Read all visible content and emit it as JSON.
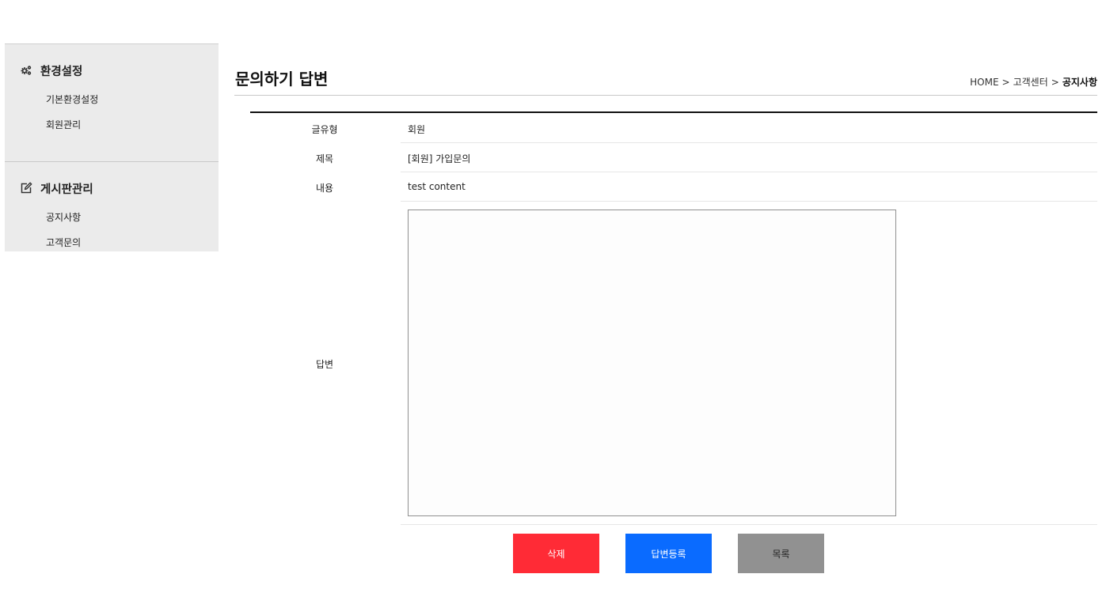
{
  "sidebar": {
    "groups": [
      {
        "title": "환경설정",
        "icon": "gears-icon",
        "items": [
          "기본환경설정",
          "회원관리"
        ]
      },
      {
        "title": "게시판관리",
        "icon": "edit-icon",
        "items": [
          "공지사항",
          "고객문의"
        ]
      }
    ]
  },
  "page": {
    "title": "문의하기 답변"
  },
  "breadcrumb": {
    "home": "HOME",
    "separator": ">",
    "section": "고객센터",
    "current": "공지사항"
  },
  "form": {
    "type_label": "글유형",
    "type_value": "회원",
    "subject_label": "제목",
    "subject_value": "[회원] 가입문의",
    "content_label": "내용",
    "content_value": "test content",
    "answer_label": "답변",
    "answer_value": ""
  },
  "buttons": {
    "delete": "삭제",
    "register": "답변등록",
    "list": "목록"
  },
  "colors": {
    "delete": "#ff2b36",
    "register": "#0a6bff",
    "list": "#919191",
    "sidebar_bg": "#ebebeb"
  }
}
